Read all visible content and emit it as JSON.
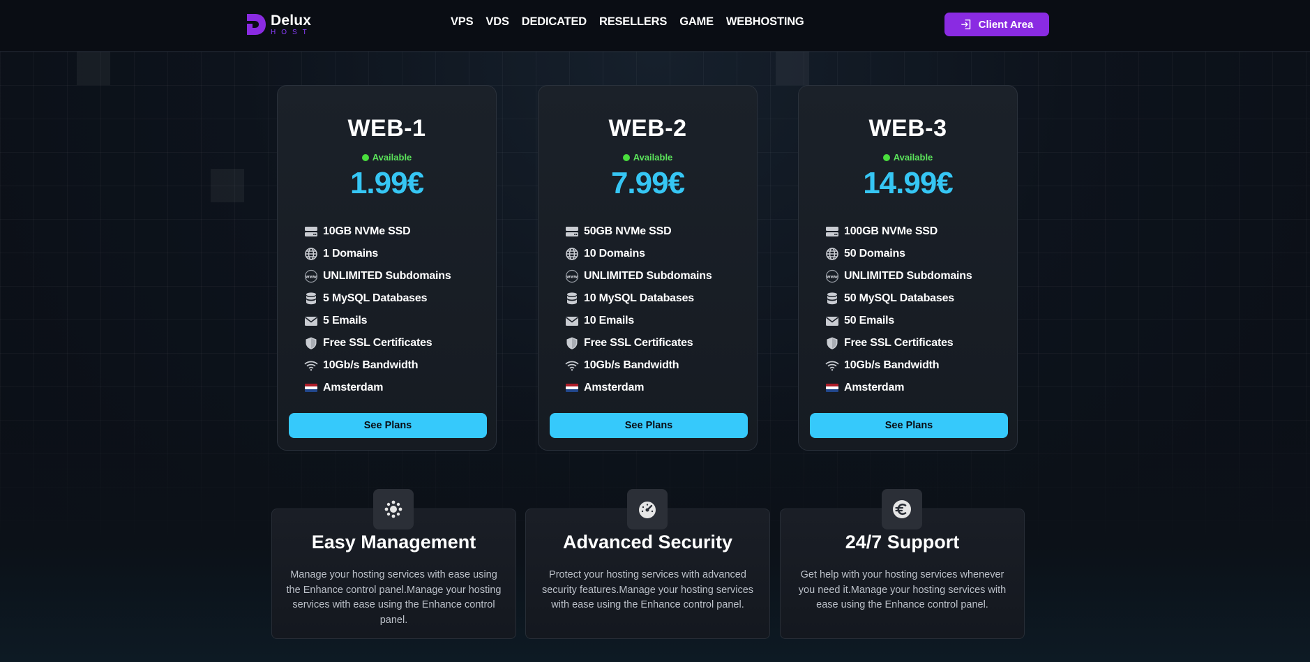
{
  "brand": {
    "name": "Delux",
    "sub": "HOST",
    "accent": "#8a2be2"
  },
  "nav": {
    "items": [
      "VPS",
      "VDS",
      "DEDICATED",
      "RESELLERS",
      "GAME",
      "WEBHOSTING"
    ],
    "client_area": "Client Area"
  },
  "plans": [
    {
      "name": "WEB-1",
      "status": "Available",
      "price": "1.99€",
      "features": [
        "10GB NVMe SSD",
        "1 Domains",
        "UNLIMITED Subdomains",
        "5 MySQL Databases",
        "5 Emails",
        "Free SSL Certificates",
        "10Gb/s Bandwidth",
        "Amsterdam"
      ],
      "button": "See Plans"
    },
    {
      "name": "WEB-2",
      "status": "Available",
      "price": "7.99€",
      "features": [
        "50GB NVMe SSD",
        "10 Domains",
        "UNLIMITED Subdomains",
        "10 MySQL Databases",
        "10 Emails",
        "Free SSL Certificates",
        "10Gb/s Bandwidth",
        "Amsterdam"
      ],
      "button": "See Plans"
    },
    {
      "name": "WEB-3",
      "status": "Available",
      "price": "14.99€",
      "features": [
        "100GB NVMe SSD",
        "50 Domains",
        "UNLIMITED Subdomains",
        "50 MySQL Databases",
        "50 Emails",
        "Free SSL Certificates",
        "10Gb/s Bandwidth",
        "Amsterdam"
      ],
      "button": "See Plans"
    }
  ],
  "feature_icons": [
    "server-icon",
    "globe-icon",
    "www-icon",
    "database-icon",
    "envelope-icon",
    "shield-icon",
    "wifi-icon",
    "netherlands-flag-icon"
  ],
  "highlights": [
    {
      "icon": "gear-icon",
      "title": "Easy Management",
      "text": "Manage your hosting services with ease using the Enhance control panel.Manage your hosting services with ease using the Enhance control panel."
    },
    {
      "icon": "speedometer-icon",
      "title": "Advanced Security",
      "text": "Protect your hosting services with advanced security features.Manage your hosting services with ease using the Enhance control panel."
    },
    {
      "icon": "euro-icon",
      "title": "24/7 Support",
      "text": "Get help with your hosting services whenever you need it.Manage your hosting services with ease using the Enhance control panel."
    }
  ],
  "colors": {
    "price": "#36c6f4",
    "button": "#36c9fb",
    "available": "#4ade3d"
  }
}
